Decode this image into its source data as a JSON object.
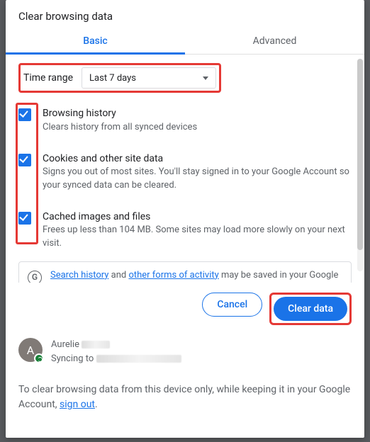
{
  "title": "Clear browsing data",
  "tabs": {
    "basic": "Basic",
    "advanced": "Advanced"
  },
  "time_range": {
    "label": "Time range",
    "value": "Last 7 days"
  },
  "items": [
    {
      "title": "Browsing history",
      "desc": "Clears history from all synced devices"
    },
    {
      "title": "Cookies and other site data",
      "desc": "Signs you out of most sites. You'll stay signed in to your Google Account so your synced data can be cleared."
    },
    {
      "title": "Cached images and files",
      "desc": "Frees up less than 104 MB. Some sites may load more slowly on your next visit."
    }
  ],
  "info": {
    "link1": "Search history",
    "mid1": " and ",
    "link2": "other forms of activity",
    "rest": " may be saved in your Google Account when you're signed in. You can delete them anytime."
  },
  "buttons": {
    "cancel": "Cancel",
    "clear": "Clear data"
  },
  "account": {
    "initial": "A",
    "name_prefix": "Aurelie",
    "sync_prefix": "Syncing to"
  },
  "footer": {
    "text": "To clear browsing data from this device only, while keeping it in your Google Account, ",
    "link": "sign out",
    "suffix": "."
  }
}
